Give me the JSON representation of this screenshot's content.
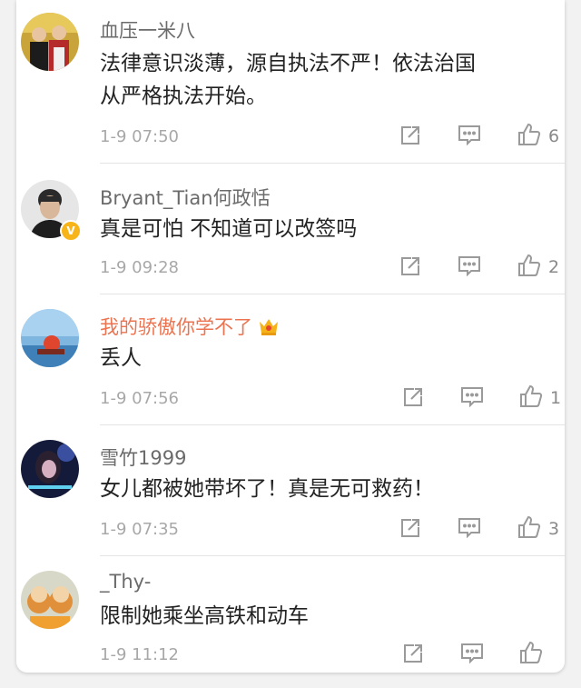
{
  "comments": [
    {
      "username": "血压一米八",
      "text": "法律意识淡薄，源自执法不严！依法治国从严格执法开始。",
      "time": "1-9 07:50",
      "likes": "6",
      "verified": false,
      "vip": false
    },
    {
      "username": "Bryant_Tian何政恬",
      "text": "真是可怕 不知道可以改签吗",
      "time": "1-9 09:28",
      "likes": "2",
      "verified": true,
      "vip": false
    },
    {
      "username": "我的骄傲你学不了",
      "text": "丢人",
      "time": "1-9 07:56",
      "likes": "1",
      "verified": false,
      "vip": true
    },
    {
      "username": "雪竹1999",
      "text": "女儿都被她带坏了！真是无可救药！",
      "time": "1-9 07:35",
      "likes": "3",
      "verified": false,
      "vip": false
    },
    {
      "username": "_Thy-",
      "text": "限制她乘坐高铁和动车",
      "time": "1-9 11:12",
      "likes": "",
      "verified": false,
      "vip": false
    }
  ],
  "icons": {
    "repost": "share-icon",
    "comment": "comment-icon",
    "like": "thumbs-up-icon",
    "verified": "verified-badge-icon",
    "vip": "crown-icon"
  },
  "colors": {
    "username": "#6b6b6b",
    "vip_username": "#eb7350",
    "body_text": "#222222",
    "timestamp": "#a8a8a8",
    "icon": "#9a9a9a",
    "verified_badge": "#f7b51a"
  }
}
